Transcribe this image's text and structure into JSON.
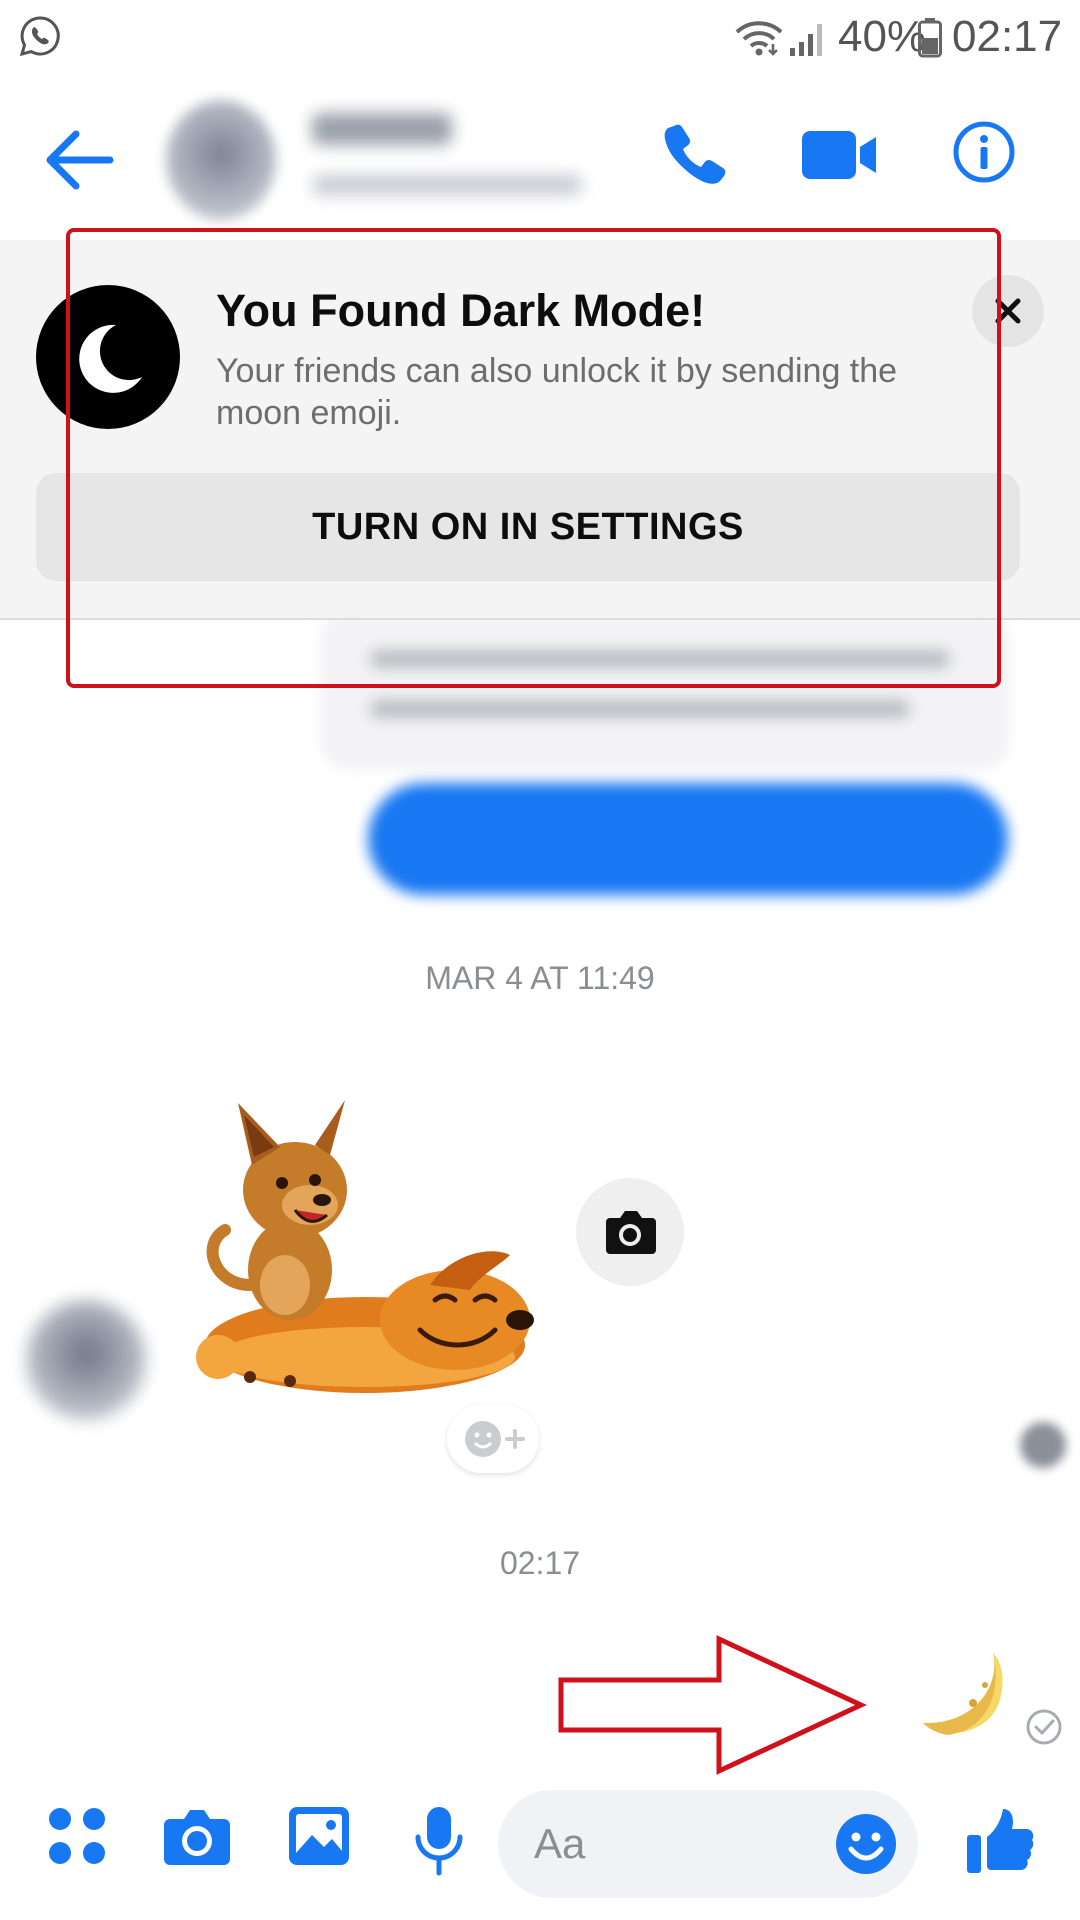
{
  "status_bar": {
    "battery_percent": "40%",
    "time": "02:17",
    "icons": [
      "whatsapp-icon",
      "wifi-icon",
      "signal-icon",
      "battery-icon"
    ]
  },
  "header": {
    "icons": [
      "back-arrow-icon",
      "phone-icon",
      "video-camera-icon",
      "info-icon"
    ],
    "accent_color": "#1877f2"
  },
  "banner": {
    "title": "You Found Dark Mode!",
    "body": "Your friends can also unlock it by sending the moon emoji.",
    "button_label": "TURN ON IN SETTINGS",
    "icons": [
      "crescent-moon-icon",
      "close-icon"
    ]
  },
  "conversation": {
    "timestamp_1": "MAR 4 AT 11:49",
    "timestamp_2": "02:17",
    "sticker": "cat-and-dog-sticker",
    "moon_emoji": "🌙"
  },
  "composer": {
    "placeholder": "Aa",
    "icons": [
      "apps-icon",
      "camera-icon",
      "gallery-icon",
      "microphone-icon",
      "emoji-icon",
      "thumbs-up-icon"
    ]
  },
  "annotation_color": "#d0101a"
}
